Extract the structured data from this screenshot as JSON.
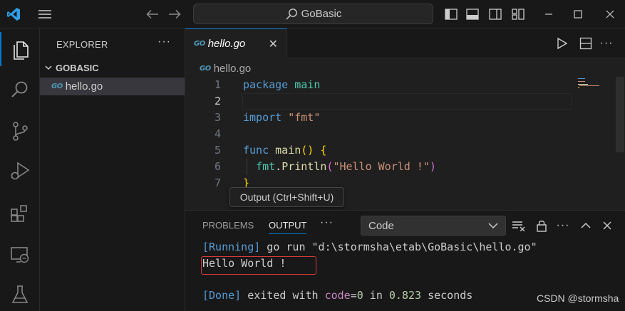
{
  "titlebar": {
    "search_text": "GoBasic",
    "icons": [
      "vscode-logo-icon",
      "menu-icon",
      "back-arrow-icon",
      "forward-arrow-icon",
      "search-icon",
      "toggle-primary-sidebar-icon",
      "toggle-panel-icon",
      "toggle-secondary-sidebar-icon",
      "customize-layout-icon",
      "minimize-icon",
      "maximize-icon",
      "close-window-icon"
    ]
  },
  "activity_bar": {
    "items": [
      "explorer-icon",
      "search-icon",
      "source-control-icon",
      "run-debug-icon",
      "extensions-icon",
      "remote-explorer-icon",
      "testing-icon"
    ]
  },
  "sidebar": {
    "title": "EXPLORER",
    "more": "···",
    "folder": "GOBASIC",
    "files": [
      "hello.go"
    ]
  },
  "editor": {
    "tab_label": "hello.go",
    "breadcrumb": "hello.go",
    "file_badge": "GO",
    "lines": [
      {
        "num": "1",
        "tokens": [
          {
            "t": "package",
            "c": "kw"
          },
          {
            "t": " ",
            "c": "plain"
          },
          {
            "t": "main",
            "c": "pk"
          }
        ]
      },
      {
        "num": "2",
        "tokens": []
      },
      {
        "num": "3",
        "tokens": [
          {
            "t": "import",
            "c": "kw"
          },
          {
            "t": " ",
            "c": "plain"
          },
          {
            "t": "\"fmt\"",
            "c": "str"
          }
        ]
      },
      {
        "num": "4",
        "tokens": []
      },
      {
        "num": "5",
        "tokens": [
          {
            "t": "func",
            "c": "kw"
          },
          {
            "t": " ",
            "c": "plain"
          },
          {
            "t": "main",
            "c": "fn"
          },
          {
            "t": "()",
            "c": "br1"
          },
          {
            "t": " ",
            "c": "plain"
          },
          {
            "t": "{",
            "c": "br1"
          }
        ]
      },
      {
        "num": "6",
        "tokens": [
          {
            "t": "  ",
            "c": "plain"
          },
          {
            "t": "fmt",
            "c": "pk"
          },
          {
            "t": ".",
            "c": "plain"
          },
          {
            "t": "Println",
            "c": "fn"
          },
          {
            "t": "(",
            "c": "br2"
          },
          {
            "t": "\"Hello World !\"",
            "c": "str"
          },
          {
            "t": ")",
            "c": "br2"
          }
        ]
      },
      {
        "num": "7",
        "tokens": [
          {
            "t": "}",
            "c": "br1"
          }
        ]
      }
    ],
    "current_line": "2"
  },
  "tooltip": "Output (Ctrl+Shift+U)",
  "panel": {
    "tabs": [
      "PROBLEMS",
      "OUTPUT"
    ],
    "active_tab": "OUTPUT",
    "more": "···",
    "channel": "Code",
    "output_lines": [
      [
        {
          "t": "[Running]",
          "c": "o-tag"
        },
        {
          "t": " go run ",
          "c": "o-text"
        },
        {
          "t": "\"d:\\stormsha\\etab\\GoBasic\\hello.go\"",
          "c": "o-text"
        }
      ],
      [
        {
          "t": "Hello World !",
          "c": "o-text"
        }
      ],
      [],
      [
        {
          "t": "[Done]",
          "c": "o-tag"
        },
        {
          "t": " exited with ",
          "c": "o-text"
        },
        {
          "t": "code",
          "c": "o-hl"
        },
        {
          "t": "=",
          "c": "o-text"
        },
        {
          "t": "0",
          "c": "o-num"
        },
        {
          "t": " in ",
          "c": "o-text"
        },
        {
          "t": "0.823",
          "c": "o-num"
        },
        {
          "t": " seconds",
          "c": "o-text"
        }
      ]
    ]
  },
  "watermark": "CSDN @stormsha",
  "colors": {
    "accent": "#0078d4",
    "background": "#1f1f1f",
    "highlight_box": "#d23c3c"
  }
}
